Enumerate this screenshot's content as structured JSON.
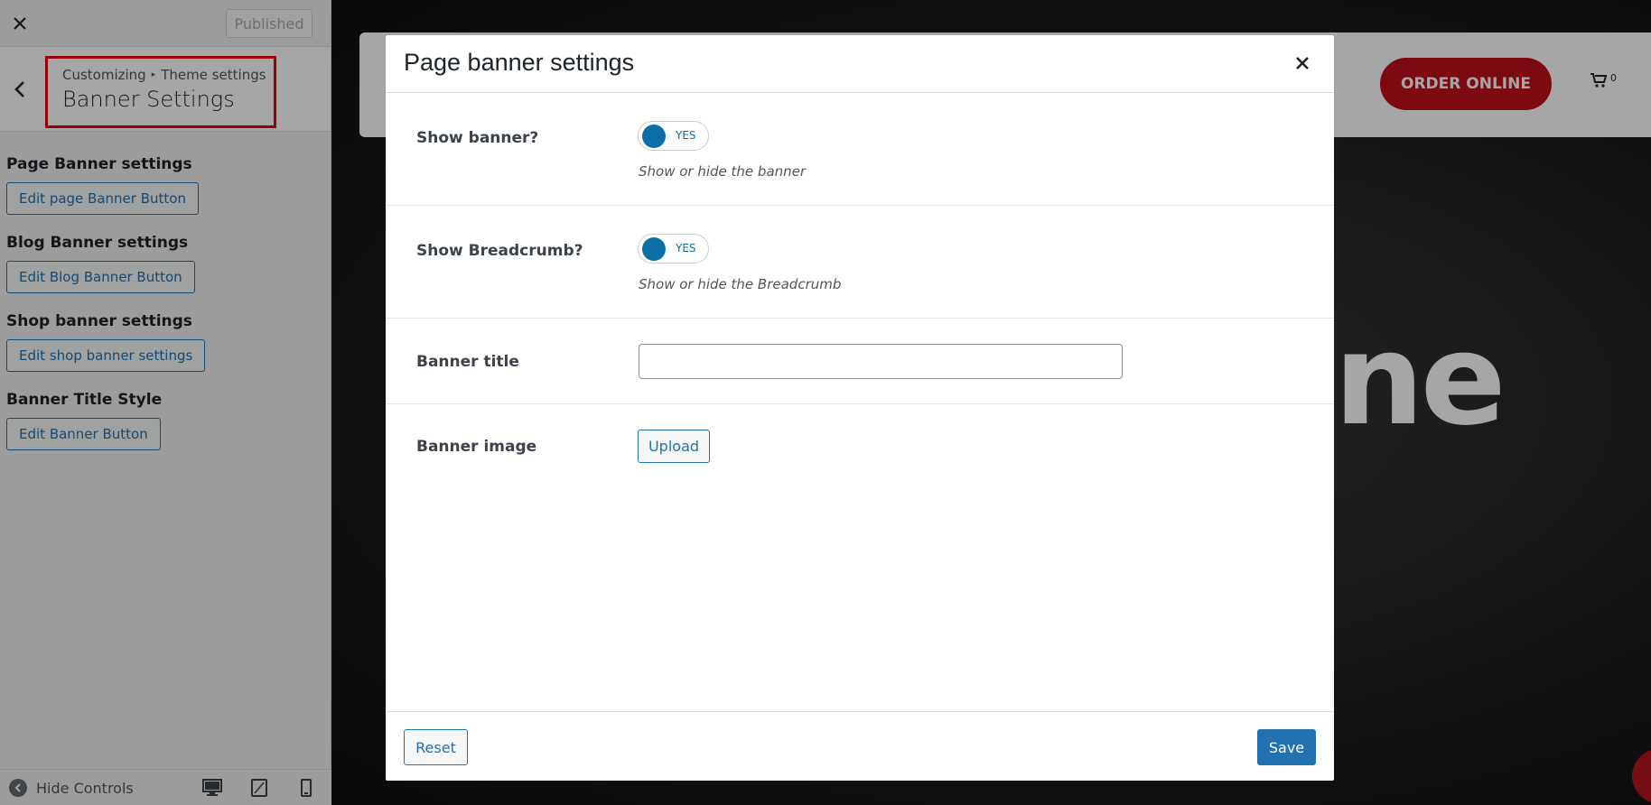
{
  "sidebar": {
    "close_icon": "close-icon",
    "published_label": "Published",
    "breadcrumb": [
      "Customizing",
      "Theme settings"
    ],
    "section_title": "Banner Settings",
    "groups": [
      {
        "title": "Page Banner settings",
        "button": "Edit page Banner Button"
      },
      {
        "title": "Blog Banner settings",
        "button": "Edit Blog Banner Button"
      },
      {
        "title": "Shop banner settings",
        "button": "Edit shop banner settings"
      },
      {
        "title": "Banner Title Style",
        "button": "Edit Banner Button"
      }
    ],
    "hide_controls_label": "Hide Controls",
    "devices": [
      "desktop-icon",
      "tablet-icon",
      "mobile-icon"
    ]
  },
  "preview": {
    "order_button": "ORDER ONLINE",
    "cart_count": "0",
    "hero_text": "ne"
  },
  "modal": {
    "title": "Page banner settings",
    "rows": {
      "show_banner": {
        "label": "Show banner?",
        "toggle": "YES",
        "hint": "Show or hide the banner"
      },
      "show_breadcrumb": {
        "label": "Show Breadcrumb?",
        "toggle": "YES",
        "hint": "Show or hide the Breadcrumb"
      },
      "banner_title": {
        "label": "Banner title",
        "value": ""
      },
      "banner_image": {
        "label": "Banner image",
        "button": "Upload"
      }
    },
    "reset_label": "Reset",
    "save_label": "Save"
  },
  "colors": {
    "accent": "#2271b1",
    "toggle": "#0c6fa6",
    "order_button": "#c0101a",
    "highlight_box": "#e3000f"
  }
}
